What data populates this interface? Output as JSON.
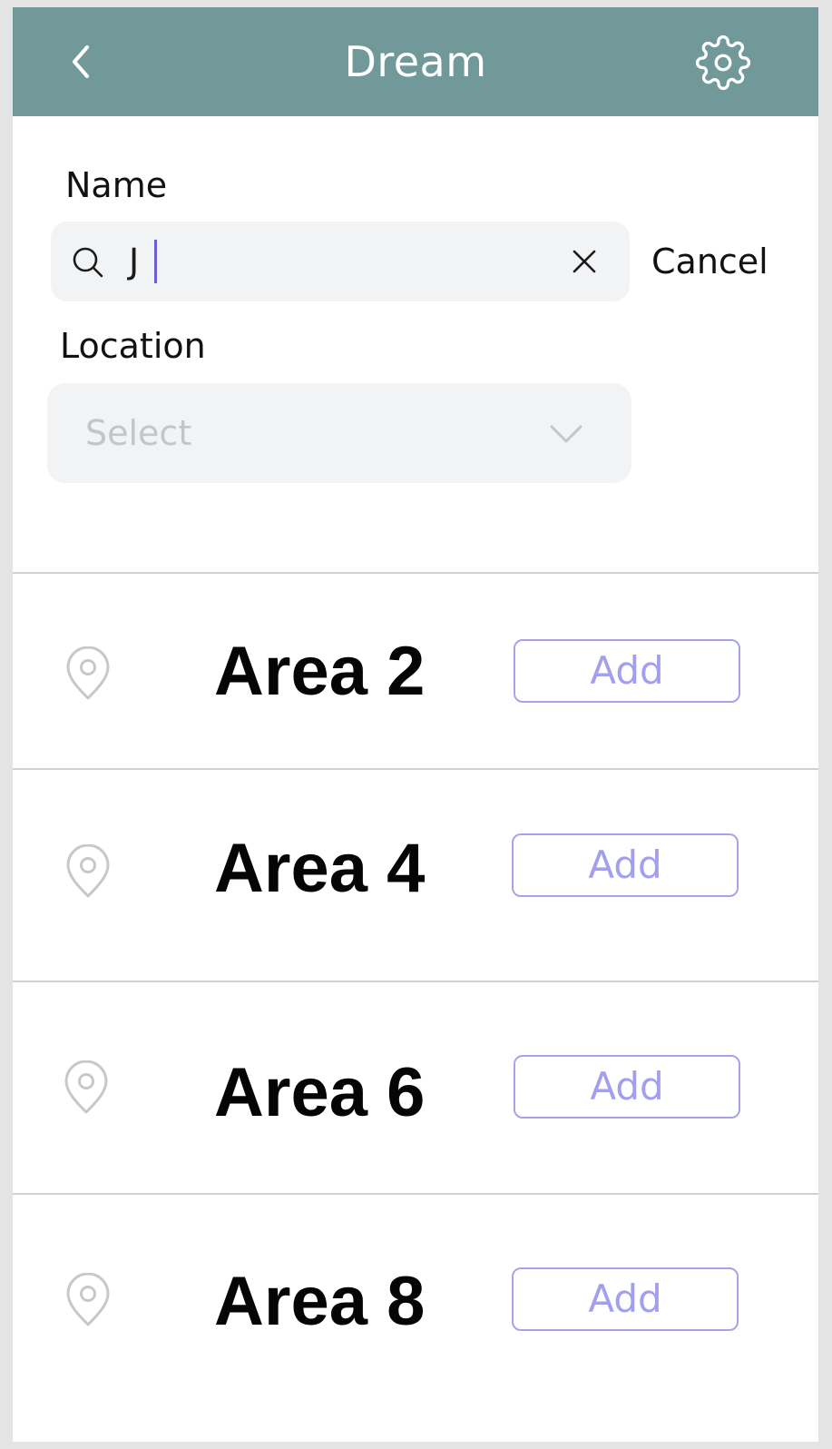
{
  "header": {
    "title": "Dream",
    "back_icon": "chevron-left-icon",
    "settings_icon": "gear-icon",
    "background_color": "#71999a"
  },
  "form": {
    "name_label": "Name",
    "search_value": "J",
    "cancel_label": "Cancel",
    "location_label": "Location",
    "location_placeholder": "Select"
  },
  "accent_color": "#a29fed",
  "areas": [
    {
      "name": "Area 2",
      "action": "Add"
    },
    {
      "name": "Area 4",
      "action": "Add"
    },
    {
      "name": "Area 6",
      "action": "Add"
    },
    {
      "name": "Area 8",
      "action": "Add"
    }
  ]
}
